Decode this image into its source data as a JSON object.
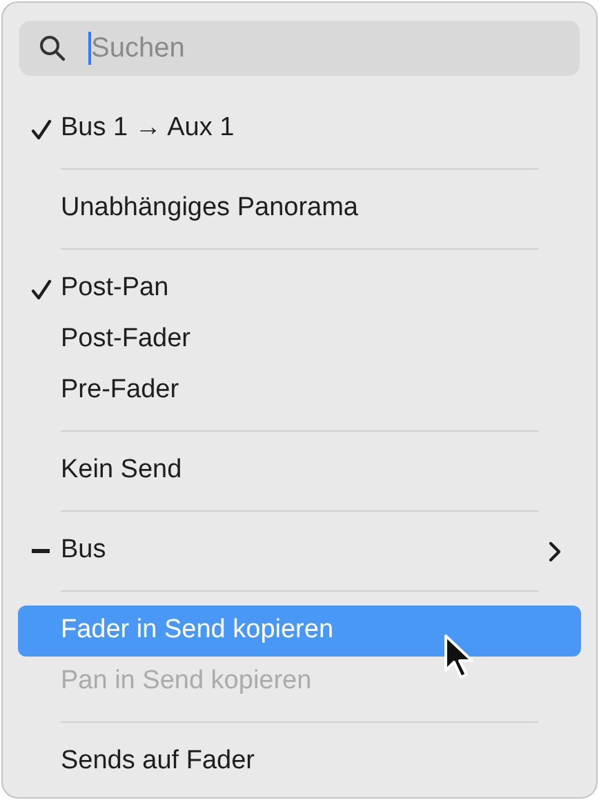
{
  "search": {
    "placeholder": "Suchen"
  },
  "sections": [
    {
      "items": [
        {
          "label": "Bus 1 → Aux 1",
          "checked": true,
          "mixed": false,
          "selected": false,
          "disabled": false,
          "submenu": false
        }
      ]
    },
    {
      "items": [
        {
          "label": "Unabhängiges Panorama",
          "checked": false,
          "mixed": false,
          "selected": false,
          "disabled": false,
          "submenu": false
        }
      ]
    },
    {
      "items": [
        {
          "label": "Post-Pan",
          "checked": true,
          "mixed": false,
          "selected": false,
          "disabled": false,
          "submenu": false
        },
        {
          "label": "Post-Fader",
          "checked": false,
          "mixed": false,
          "selected": false,
          "disabled": false,
          "submenu": false
        },
        {
          "label": "Pre-Fader",
          "checked": false,
          "mixed": false,
          "selected": false,
          "disabled": false,
          "submenu": false
        }
      ]
    },
    {
      "items": [
        {
          "label": "Kein Send",
          "checked": false,
          "mixed": false,
          "selected": false,
          "disabled": false,
          "submenu": false
        }
      ]
    },
    {
      "items": [
        {
          "label": "Bus",
          "checked": false,
          "mixed": true,
          "selected": false,
          "disabled": false,
          "submenu": true
        }
      ]
    },
    {
      "items": [
        {
          "label": "Fader in Send kopieren",
          "checked": false,
          "mixed": false,
          "selected": true,
          "disabled": false,
          "submenu": false
        },
        {
          "label": "Pan in Send kopieren",
          "checked": false,
          "mixed": false,
          "selected": false,
          "disabled": true,
          "submenu": false
        }
      ]
    },
    {
      "items": [
        {
          "label": "Sends auf Fader",
          "checked": false,
          "mixed": false,
          "selected": false,
          "disabled": false,
          "submenu": false
        }
      ]
    }
  ]
}
